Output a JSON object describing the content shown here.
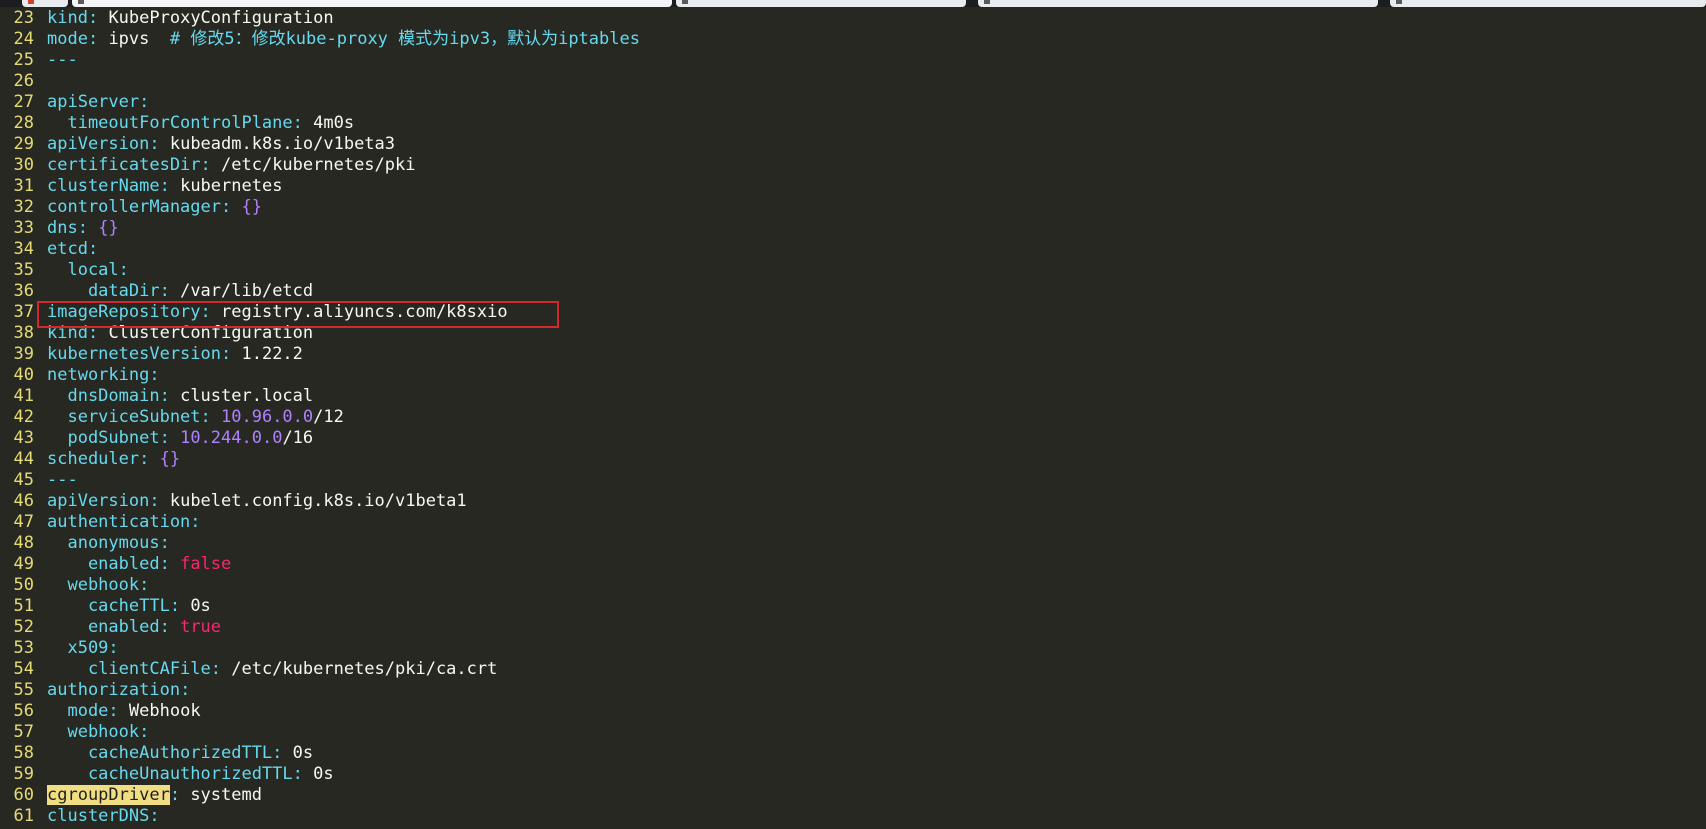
{
  "tabs": [
    {
      "icon": "app-icon",
      "active": false
    },
    {
      "icon": "document-icon",
      "active": true
    },
    {
      "icon": "document-icon",
      "active": false
    },
    {
      "icon": "document-icon",
      "active": false
    },
    {
      "icon": "document-icon",
      "active": false
    }
  ],
  "colors": {
    "background": "#272822",
    "line_number": "#e6db74",
    "key": "#66d9ef",
    "value": "#f8f8f2",
    "number": "#ae81ff",
    "boolean": "#f92672",
    "search_highlight": "#f1de82",
    "annotation_box": "#d4282f"
  },
  "editor": {
    "lines": [
      {
        "num": "23",
        "tokens": [
          {
            "t": "kind",
            "c": "key"
          },
          {
            "t": ": ",
            "c": "punc"
          },
          {
            "t": "KubeProxyConfiguration",
            "c": "val"
          }
        ]
      },
      {
        "num": "24",
        "tokens": [
          {
            "t": "mode",
            "c": "key"
          },
          {
            "t": ": ",
            "c": "punc"
          },
          {
            "t": "ipvs  ",
            "c": "val"
          },
          {
            "t": "# 修改5：修改kube-proxy 模式为ipv3，默认为iptables",
            "c": "comment"
          }
        ]
      },
      {
        "num": "25",
        "tokens": [
          {
            "t": "---",
            "c": "key"
          }
        ]
      },
      {
        "num": "26",
        "tokens": []
      },
      {
        "num": "27",
        "tokens": [
          {
            "t": "apiServer",
            "c": "key"
          },
          {
            "t": ":",
            "c": "punc"
          }
        ]
      },
      {
        "num": "28",
        "tokens": [
          {
            "t": "  timeoutForControlPlane",
            "c": "key"
          },
          {
            "t": ": ",
            "c": "punc"
          },
          {
            "t": "4m0s",
            "c": "val"
          }
        ]
      },
      {
        "num": "29",
        "tokens": [
          {
            "t": "apiVersion",
            "c": "key"
          },
          {
            "t": ": ",
            "c": "punc"
          },
          {
            "t": "kubeadm.k8s.io/v1beta3",
            "c": "val"
          }
        ]
      },
      {
        "num": "30",
        "tokens": [
          {
            "t": "certificatesDir",
            "c": "key"
          },
          {
            "t": ": ",
            "c": "punc"
          },
          {
            "t": "/etc/kubernetes/pki",
            "c": "val"
          }
        ]
      },
      {
        "num": "31",
        "tokens": [
          {
            "t": "clusterName",
            "c": "key"
          },
          {
            "t": ": ",
            "c": "punc"
          },
          {
            "t": "kubernetes",
            "c": "val"
          }
        ]
      },
      {
        "num": "32",
        "tokens": [
          {
            "t": "controllerManager",
            "c": "key"
          },
          {
            "t": ": ",
            "c": "punc"
          },
          {
            "t": "{}",
            "c": "brace"
          }
        ]
      },
      {
        "num": "33",
        "tokens": [
          {
            "t": "dns",
            "c": "key"
          },
          {
            "t": ": ",
            "c": "punc"
          },
          {
            "t": "{}",
            "c": "brace"
          }
        ]
      },
      {
        "num": "34",
        "tokens": [
          {
            "t": "etcd",
            "c": "key"
          },
          {
            "t": ":",
            "c": "punc"
          }
        ]
      },
      {
        "num": "35",
        "tokens": [
          {
            "t": "  local",
            "c": "key"
          },
          {
            "t": ":",
            "c": "punc"
          }
        ]
      },
      {
        "num": "36",
        "tokens": [
          {
            "t": "    dataDir",
            "c": "key"
          },
          {
            "t": ": ",
            "c": "punc"
          },
          {
            "t": "/var/lib/etcd",
            "c": "val"
          }
        ]
      },
      {
        "num": "37",
        "tokens": [
          {
            "t": "imageRepository",
            "c": "key"
          },
          {
            "t": ": ",
            "c": "punc"
          },
          {
            "t": "registry.aliyuncs.com/k8sxio",
            "c": "val"
          }
        ]
      },
      {
        "num": "38",
        "tokens": [
          {
            "t": "kind",
            "c": "key"
          },
          {
            "t": ": ",
            "c": "punc"
          },
          {
            "t": "ClusterConfiguration",
            "c": "val"
          }
        ]
      },
      {
        "num": "39",
        "tokens": [
          {
            "t": "kubernetesVersion",
            "c": "key"
          },
          {
            "t": ": ",
            "c": "punc"
          },
          {
            "t": "1.22.2",
            "c": "val"
          }
        ]
      },
      {
        "num": "40",
        "tokens": [
          {
            "t": "networking",
            "c": "key"
          },
          {
            "t": ":",
            "c": "punc"
          }
        ]
      },
      {
        "num": "41",
        "tokens": [
          {
            "t": "  dnsDomain",
            "c": "key"
          },
          {
            "t": ": ",
            "c": "punc"
          },
          {
            "t": "cluster.local",
            "c": "val"
          }
        ]
      },
      {
        "num": "42",
        "tokens": [
          {
            "t": "  serviceSubnet",
            "c": "key"
          },
          {
            "t": ": ",
            "c": "punc"
          },
          {
            "t": "10.96.0.0",
            "c": "num"
          },
          {
            "t": "/12",
            "c": "val"
          }
        ]
      },
      {
        "num": "43",
        "tokens": [
          {
            "t": "  podSubnet",
            "c": "key"
          },
          {
            "t": ": ",
            "c": "punc"
          },
          {
            "t": "10.244.0.0",
            "c": "num"
          },
          {
            "t": "/16",
            "c": "val"
          }
        ]
      },
      {
        "num": "44",
        "tokens": [
          {
            "t": "scheduler",
            "c": "key"
          },
          {
            "t": ": ",
            "c": "punc"
          },
          {
            "t": "{}",
            "c": "brace"
          }
        ]
      },
      {
        "num": "45",
        "tokens": [
          {
            "t": "---",
            "c": "key"
          }
        ]
      },
      {
        "num": "46",
        "tokens": [
          {
            "t": "apiVersion",
            "c": "key"
          },
          {
            "t": ": ",
            "c": "punc"
          },
          {
            "t": "kubelet.config.k8s.io/v1beta1",
            "c": "val"
          }
        ]
      },
      {
        "num": "47",
        "tokens": [
          {
            "t": "authentication",
            "c": "key"
          },
          {
            "t": ":",
            "c": "punc"
          }
        ]
      },
      {
        "num": "48",
        "tokens": [
          {
            "t": "  anonymous",
            "c": "key"
          },
          {
            "t": ":",
            "c": "punc"
          }
        ]
      },
      {
        "num": "49",
        "tokens": [
          {
            "t": "    enabled",
            "c": "key"
          },
          {
            "t": ": ",
            "c": "punc"
          },
          {
            "t": "false",
            "c": "bool"
          }
        ]
      },
      {
        "num": "50",
        "tokens": [
          {
            "t": "  webhook",
            "c": "key"
          },
          {
            "t": ":",
            "c": "punc"
          }
        ]
      },
      {
        "num": "51",
        "tokens": [
          {
            "t": "    cacheTTL",
            "c": "key"
          },
          {
            "t": ": ",
            "c": "punc"
          },
          {
            "t": "0s",
            "c": "val"
          }
        ]
      },
      {
        "num": "52",
        "tokens": [
          {
            "t": "    enabled",
            "c": "key"
          },
          {
            "t": ": ",
            "c": "punc"
          },
          {
            "t": "true",
            "c": "bool"
          }
        ]
      },
      {
        "num": "53",
        "tokens": [
          {
            "t": "  x509",
            "c": "key"
          },
          {
            "t": ":",
            "c": "punc"
          }
        ]
      },
      {
        "num": "54",
        "tokens": [
          {
            "t": "    clientCAFile",
            "c": "key"
          },
          {
            "t": ": ",
            "c": "punc"
          },
          {
            "t": "/etc/kubernetes/pki/ca.crt",
            "c": "val"
          }
        ]
      },
      {
        "num": "55",
        "tokens": [
          {
            "t": "authorization",
            "c": "key"
          },
          {
            "t": ":",
            "c": "punc"
          }
        ]
      },
      {
        "num": "56",
        "tokens": [
          {
            "t": "  mode",
            "c": "key"
          },
          {
            "t": ": ",
            "c": "punc"
          },
          {
            "t": "Webhook",
            "c": "val"
          }
        ]
      },
      {
        "num": "57",
        "tokens": [
          {
            "t": "  webhook",
            "c": "key"
          },
          {
            "t": ":",
            "c": "punc"
          }
        ]
      },
      {
        "num": "58",
        "tokens": [
          {
            "t": "    cacheAuthorizedTTL",
            "c": "key"
          },
          {
            "t": ": ",
            "c": "punc"
          },
          {
            "t": "0s",
            "c": "val"
          }
        ]
      },
      {
        "num": "59",
        "tokens": [
          {
            "t": "    cacheUnauthorizedTTL",
            "c": "key"
          },
          {
            "t": ": ",
            "c": "punc"
          },
          {
            "t": "0s",
            "c": "val"
          }
        ]
      },
      {
        "num": "60",
        "tokens": [
          {
            "t": "cgroupDriver",
            "c": "hl"
          },
          {
            "t": ": ",
            "c": "punc"
          },
          {
            "t": "systemd",
            "c": "val"
          }
        ]
      },
      {
        "num": "61",
        "tokens": [
          {
            "t": "clusterDNS",
            "c": "key"
          },
          {
            "t": ":",
            "c": "punc"
          }
        ]
      }
    ]
  }
}
